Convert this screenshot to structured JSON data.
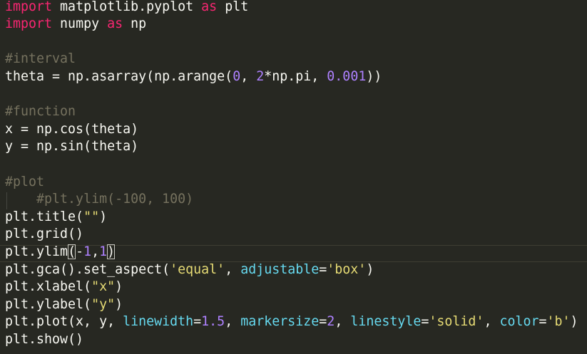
{
  "editor": {
    "lines": [
      {
        "id": 0,
        "parts": [
          [
            "kw",
            "import"
          ],
          [
            "plain",
            " matplotlib.pyplot "
          ],
          [
            "kw",
            "as"
          ],
          [
            "plain",
            " plt"
          ]
        ]
      },
      {
        "id": 1,
        "parts": [
          [
            "kw",
            "import"
          ],
          [
            "plain",
            " numpy "
          ],
          [
            "kw",
            "as"
          ],
          [
            "plain",
            " np"
          ]
        ]
      },
      {
        "id": 2,
        "parts": []
      },
      {
        "id": 3,
        "parts": [
          [
            "cm",
            "#interval"
          ]
        ]
      },
      {
        "id": 4,
        "parts": [
          [
            "plain",
            "theta = np.asarray(np.arange("
          ],
          [
            "num",
            "0"
          ],
          [
            "plain",
            ", "
          ],
          [
            "num",
            "2"
          ],
          [
            "plain",
            "*np.pi, "
          ],
          [
            "num",
            "0.001"
          ],
          [
            "plain",
            "))"
          ]
        ]
      },
      {
        "id": 5,
        "parts": []
      },
      {
        "id": 6,
        "parts": [
          [
            "cm",
            "#function"
          ]
        ]
      },
      {
        "id": 7,
        "parts": [
          [
            "plain",
            "x = np.cos(theta)"
          ]
        ]
      },
      {
        "id": 8,
        "parts": [
          [
            "plain",
            "y = np.sin(theta)"
          ]
        ]
      },
      {
        "id": 9,
        "parts": []
      },
      {
        "id": 10,
        "parts": [
          [
            "cm",
            "#plot"
          ]
        ]
      },
      {
        "id": 11,
        "parts": [
          [
            "plain",
            "    "
          ],
          [
            "cm",
            "#plt.ylim(-100, 100)"
          ]
        ]
      },
      {
        "id": 12,
        "parts": [
          [
            "plain",
            "plt.title("
          ],
          [
            "str",
            "\"\""
          ],
          [
            "plain",
            ")"
          ]
        ]
      },
      {
        "id": 13,
        "parts": [
          [
            "plain",
            "plt.grid()"
          ]
        ]
      },
      {
        "id": 14,
        "parts": [
          [
            "plain",
            "plt.ylim"
          ],
          [
            "bracket",
            "("
          ],
          [
            "plain",
            "-"
          ],
          [
            "num",
            "1"
          ],
          [
            "plain",
            ","
          ],
          [
            "num",
            "1"
          ],
          [
            "bracket",
            ")"
          ]
        ]
      },
      {
        "id": 15,
        "parts": [
          [
            "plain",
            "plt.gca().set_aspect("
          ],
          [
            "str",
            "'equal'"
          ],
          [
            "plain",
            ", "
          ],
          [
            "arg",
            "adjustable"
          ],
          [
            "plain",
            "="
          ],
          [
            "str",
            "'box'"
          ],
          [
            "plain",
            ")"
          ]
        ]
      },
      {
        "id": 16,
        "parts": [
          [
            "plain",
            "plt.xlabel("
          ],
          [
            "str",
            "\"x\""
          ],
          [
            "plain",
            ")"
          ]
        ]
      },
      {
        "id": 17,
        "parts": [
          [
            "plain",
            "plt.ylabel("
          ],
          [
            "str",
            "\"y\""
          ],
          [
            "plain",
            ")"
          ]
        ]
      },
      {
        "id": 18,
        "parts": [
          [
            "plain",
            "plt.plot(x, y, "
          ],
          [
            "arg",
            "linewidth"
          ],
          [
            "plain",
            "="
          ],
          [
            "num",
            "1.5"
          ],
          [
            "plain",
            ", "
          ],
          [
            "arg",
            "markersize"
          ],
          [
            "plain",
            "="
          ],
          [
            "num",
            "2"
          ],
          [
            "plain",
            ", "
          ],
          [
            "arg",
            "linestyle"
          ],
          [
            "plain",
            "="
          ],
          [
            "str",
            "'solid'"
          ],
          [
            "plain",
            ", "
          ],
          [
            "arg",
            "color"
          ],
          [
            "plain",
            "="
          ],
          [
            "str",
            "'b'"
          ],
          [
            "plain",
            ")"
          ]
        ]
      },
      {
        "id": 19,
        "parts": [
          [
            "plain",
            "plt.show()"
          ]
        ]
      }
    ],
    "current_line": 14
  },
  "colors": {
    "background": "#272822",
    "keyword": "#f92672",
    "comment": "#75715e",
    "number": "#ae81ff",
    "string": "#e6db74",
    "argument": "#66d9ef",
    "text": "#f8f8f2"
  }
}
